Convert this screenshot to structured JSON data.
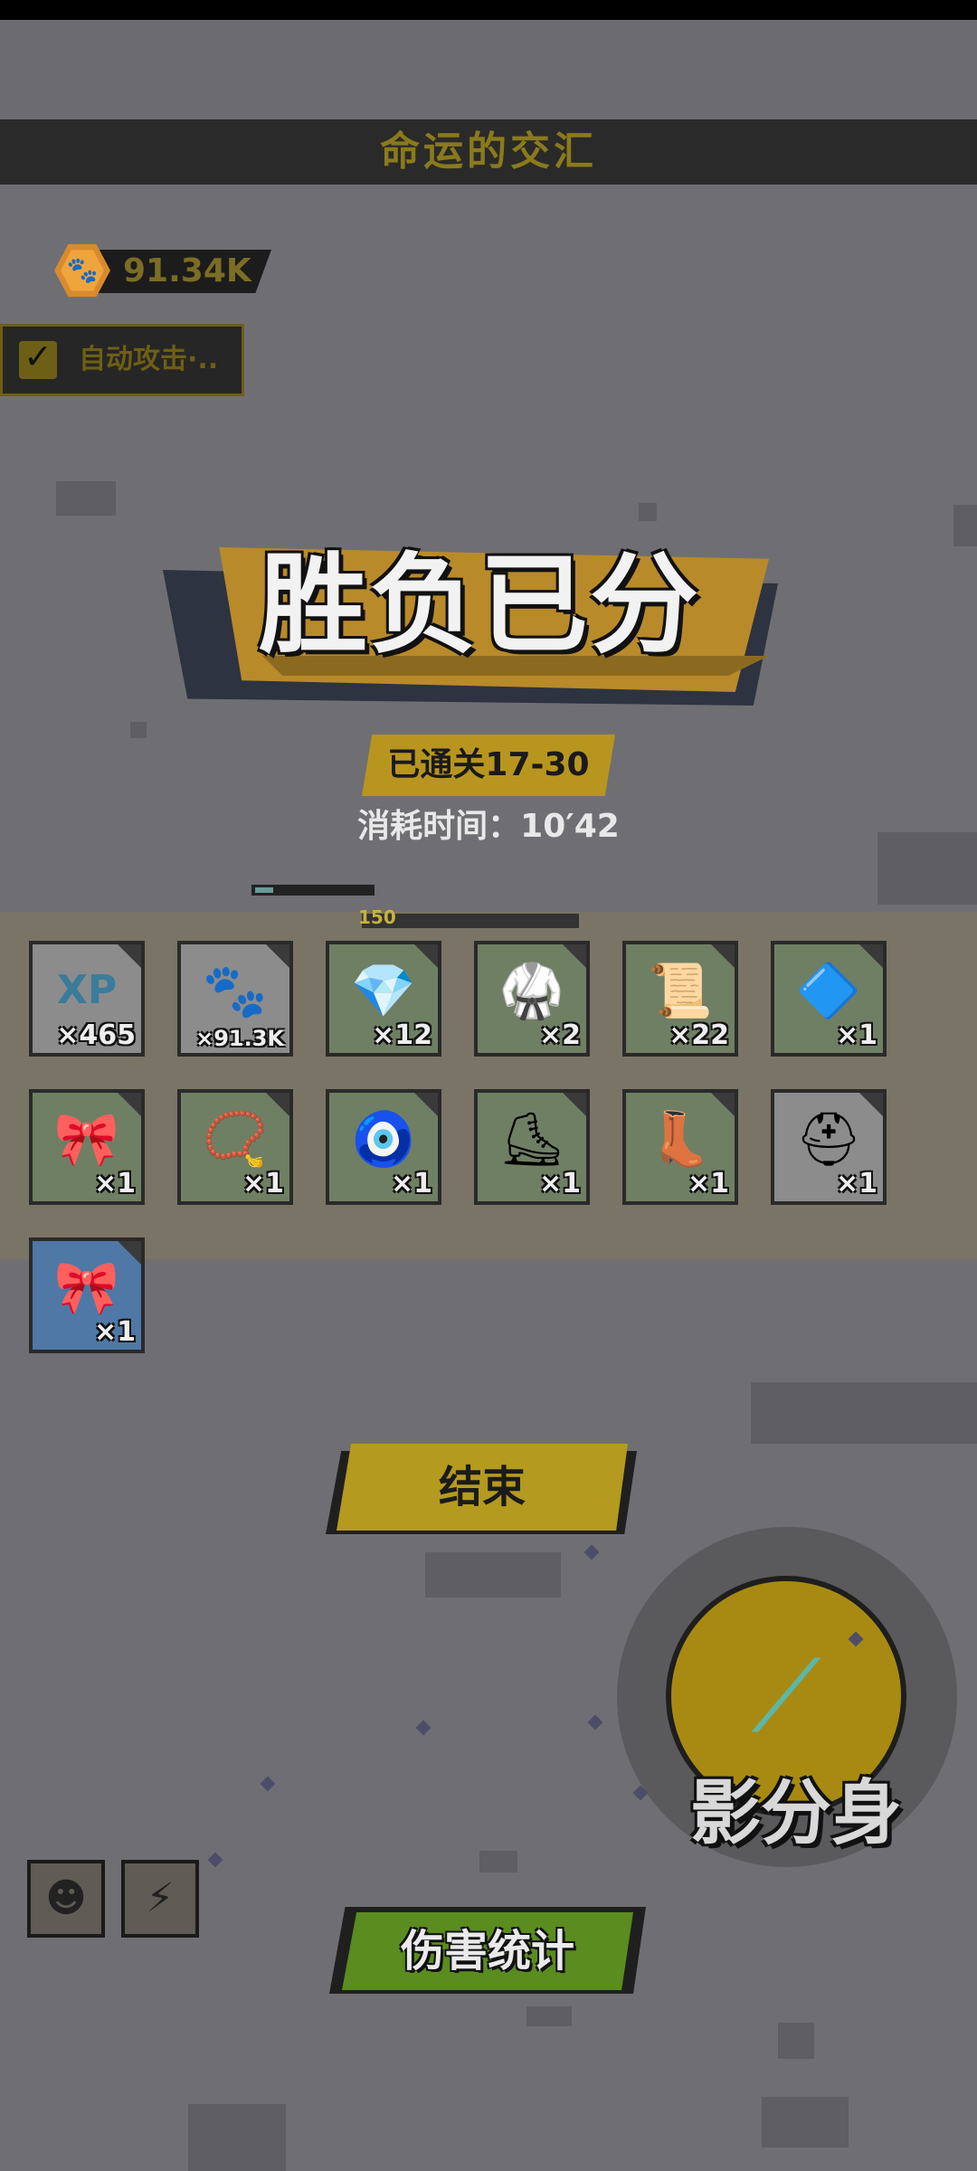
{
  "header": {
    "title": "命运的交汇"
  },
  "currency": {
    "icon": "paw-coin-icon",
    "value": "91.34K"
  },
  "auto_attack": {
    "label": "自动攻击·..",
    "checked": true
  },
  "result": {
    "banner": "胜负已分",
    "stage": "已通关17-30",
    "time": "消耗时间：10′42"
  },
  "status": {
    "level": "150"
  },
  "rewards": [
    {
      "name": "xp-orb-icon",
      "glyph": "XP",
      "qty": "×465",
      "bg": "gray"
    },
    {
      "name": "paw-coin-icon",
      "glyph": "🐾",
      "qty": "×91.3K",
      "bg": "gray",
      "small": true
    },
    {
      "name": "purple-gem-icon",
      "glyph": "💎",
      "qty": "×12",
      "bg": "green"
    },
    {
      "name": "robe-icon",
      "glyph": "🥋",
      "qty": "×2",
      "bg": "green"
    },
    {
      "name": "scroll-icon",
      "glyph": "📜",
      "qty": "×22",
      "bg": "green"
    },
    {
      "name": "crystal-pendant-icon",
      "glyph": "🔷",
      "qty": "×1",
      "bg": "green"
    },
    {
      "name": "cyan-sash-icon",
      "glyph": "🎀",
      "qty": "×1",
      "bg": "green"
    },
    {
      "name": "gold-necklace-icon",
      "glyph": "📿",
      "qty": "×1",
      "bg": "green"
    },
    {
      "name": "jewel-necklace-icon",
      "glyph": "🧿",
      "qty": "×1",
      "bg": "green"
    },
    {
      "name": "roller-skate-icon",
      "glyph": "⛸",
      "qty": "×1",
      "bg": "green"
    },
    {
      "name": "blue-boot-icon",
      "glyph": "👢",
      "qty": "×1",
      "bg": "green"
    },
    {
      "name": "red-helmet-icon",
      "glyph": "⛑",
      "qty": "×1",
      "bg": "gray"
    },
    {
      "name": "blue-sash-icon",
      "glyph": "🎀",
      "qty": "×1",
      "bg": "blue"
    }
  ],
  "buttons": {
    "end": "结束",
    "damage_stats": "伤害统计"
  },
  "skill": {
    "label": "影分身",
    "icon": "shadow-clone-icon"
  },
  "buffs": [
    {
      "name": "demon-mask-icon",
      "glyph": "☻"
    },
    {
      "name": "lightning-icon",
      "glyph": "⚡"
    }
  ]
}
